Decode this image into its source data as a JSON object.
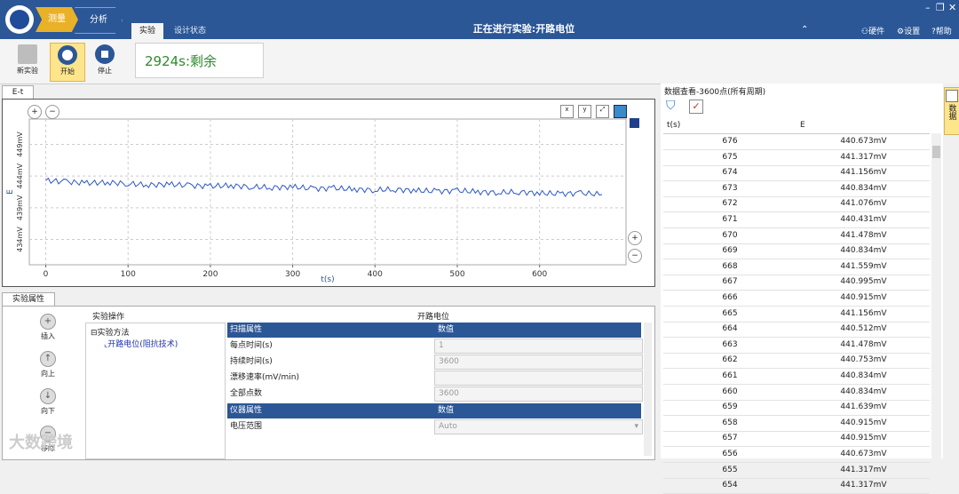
{
  "titlebar": {
    "crumb_measure": "测量",
    "crumb_analyze": "分析",
    "tab_experiment": "实验",
    "tab_design_status": "设计状态",
    "window_title": "正在进行实验:开路电位",
    "hardware": "硬件",
    "settings": "设置",
    "help": "帮助"
  },
  "toolbar": {
    "new_experiment": "新实验",
    "start": "开始",
    "stop": "停止",
    "timer_text": "2924s:剩余"
  },
  "chart_tab": "E-t",
  "chart_data": {
    "type": "line",
    "xlabel": "t(s)",
    "ylabel": "E",
    "x_ticks": [
      0,
      100,
      200,
      300,
      400,
      500,
      600
    ],
    "y_ticks": [
      "434mV",
      "439mV",
      "444mV",
      "449mV"
    ],
    "y_tick_values": [
      434,
      439,
      444,
      449
    ],
    "xlim": [
      -20,
      705
    ],
    "ylim": [
      430,
      453
    ],
    "grid": true,
    "legend_position": "top-right",
    "series": [
      {
        "color": "#2c56c8",
        "x": [
          0,
          25,
          50,
          75,
          100,
          125,
          150,
          175,
          200,
          225,
          250,
          275,
          300,
          325,
          350,
          375,
          400,
          425,
          450,
          475,
          500,
          525,
          550,
          575,
          600,
          625,
          650,
          676
        ],
        "y": [
          443.3,
          443.1,
          442.9,
          443.0,
          442.8,
          442.6,
          442.7,
          442.5,
          442.4,
          442.5,
          442.3,
          442.2,
          442.3,
          442.0,
          442.1,
          441.9,
          441.8,
          441.9,
          441.7,
          441.6,
          441.7,
          441.5,
          441.4,
          441.5,
          441.3,
          441.2,
          441.3,
          441.1
        ]
      }
    ]
  },
  "props": {
    "tab": "实验属性",
    "btn_insert": "插入",
    "btn_up": "向上",
    "btn_down": "向下",
    "btn_move": "移除",
    "ops_header": "实验操作",
    "method_header": "开路电位",
    "tree_root": "实验方法",
    "tree_child": "开路电位(阻抗技术)",
    "scan_props": "扫描属性",
    "value_header": "数值",
    "rows1": [
      {
        "name": "每点时间(s)",
        "value": "1"
      },
      {
        "name": "持续时间(s)",
        "value": "3600"
      },
      {
        "name": "漂移速率(mV/min)",
        "value": ""
      },
      {
        "name": "全部点数",
        "value": "3600"
      }
    ],
    "instrument_props": "仪器属性",
    "rows2": [
      {
        "name": "电压范围",
        "value": "Auto"
      }
    ]
  },
  "data_view": {
    "title": "数据查看-3600点(所有周期)",
    "col_t": "t(s)",
    "col_e": "E",
    "side_button": "数据",
    "rows": [
      [
        "676",
        "440.673mV"
      ],
      [
        "675",
        "441.317mV"
      ],
      [
        "674",
        "441.156mV"
      ],
      [
        "673",
        "440.834mV"
      ],
      [
        "672",
        "441.076mV"
      ],
      [
        "671",
        "440.431mV"
      ],
      [
        "670",
        "441.478mV"
      ],
      [
        "669",
        "440.834mV"
      ],
      [
        "668",
        "441.559mV"
      ],
      [
        "667",
        "440.995mV"
      ],
      [
        "666",
        "440.915mV"
      ],
      [
        "665",
        "441.156mV"
      ],
      [
        "664",
        "440.512mV"
      ],
      [
        "663",
        "441.478mV"
      ],
      [
        "662",
        "440.753mV"
      ],
      [
        "661",
        "440.834mV"
      ],
      [
        "660",
        "440.834mV"
      ],
      [
        "659",
        "441.639mV"
      ],
      [
        "658",
        "440.915mV"
      ],
      [
        "657",
        "440.915mV"
      ],
      [
        "656",
        "440.673mV"
      ],
      [
        "655",
        "441.317mV"
      ],
      [
        "654",
        "441.317mV"
      ]
    ]
  },
  "watermark": "大数跨境"
}
